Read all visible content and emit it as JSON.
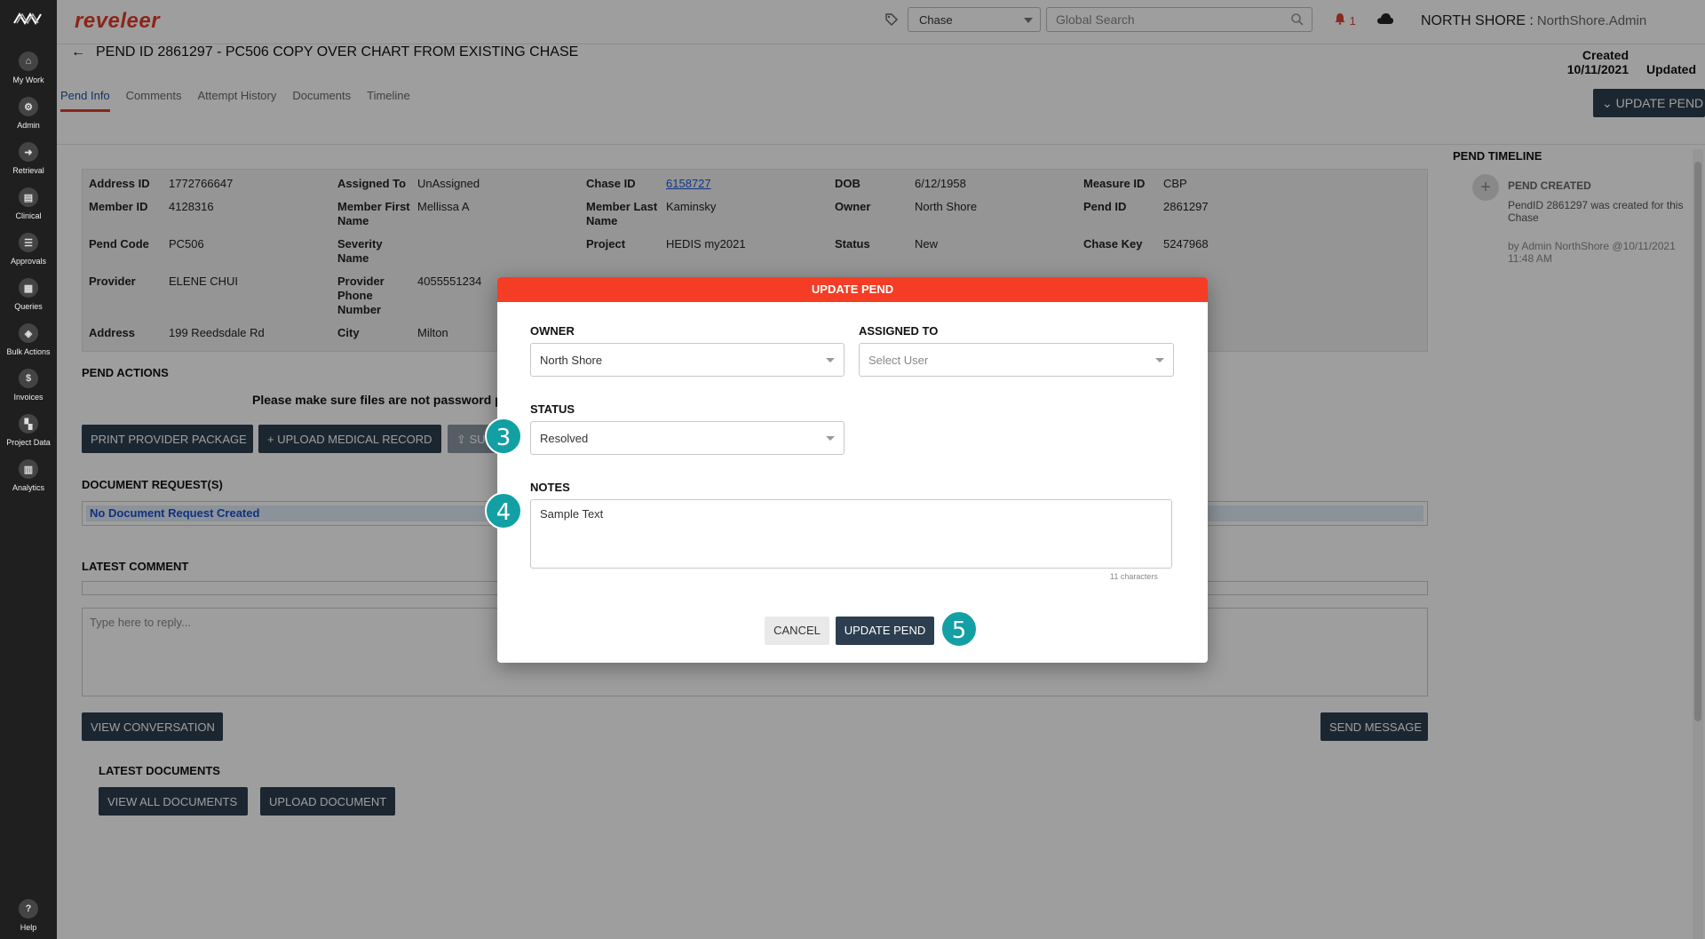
{
  "app": {
    "brand": "reveleer"
  },
  "sidebar": {
    "items": [
      {
        "label": "My Work",
        "icon": "home-icon",
        "glyph": "⌂"
      },
      {
        "label": "Admin",
        "icon": "admin-icon",
        "glyph": "⚙"
      },
      {
        "label": "Retrieval",
        "icon": "retrieval-icon",
        "glyph": "➜"
      },
      {
        "label": "Clinical",
        "icon": "clinical-icon",
        "glyph": "▤"
      },
      {
        "label": "Approvals",
        "icon": "approvals-icon",
        "glyph": "☰"
      },
      {
        "label": "Queries",
        "icon": "queries-icon",
        "glyph": "▦"
      },
      {
        "label": "Bulk Actions",
        "icon": "bulk-actions-icon",
        "glyph": "◈"
      },
      {
        "label": "Invoices",
        "icon": "invoices-icon",
        "glyph": "$"
      },
      {
        "label": "Project Data",
        "icon": "project-data-icon",
        "glyph": "▚"
      },
      {
        "label": "Analytics",
        "icon": "analytics-icon",
        "glyph": "▥"
      }
    ],
    "help": {
      "label": "Help",
      "glyph": "?"
    }
  },
  "header": {
    "search_type": "Chase",
    "search_placeholder": "Global Search",
    "notifications": "1",
    "org": "NORTH SHORE :",
    "user": "NorthShore.Admin"
  },
  "page": {
    "title": "PEND ID 2861297 - PC506 COPY OVER CHART FROM EXISTING CHASE",
    "created_label": "Created",
    "created_date": "10/11/2021",
    "updated_label": "Updated",
    "update_button": "UPDATE PEND",
    "tabs": [
      "Pend Info",
      "Comments",
      "Attempt History",
      "Documents",
      "Timeline"
    ]
  },
  "info": {
    "address_id": {
      "label": "Address ID",
      "value": "1772766647"
    },
    "member_id": {
      "label": "Member ID",
      "value": "4128316"
    },
    "pend_code": {
      "label": "Pend Code",
      "value": "PC506"
    },
    "provider": {
      "label": "Provider",
      "value": "ELENE CHUI"
    },
    "address": {
      "label": "Address",
      "value": "199 Reedsdale Rd"
    },
    "assigned_to": {
      "label": "Assigned To",
      "value": "UnAssigned"
    },
    "member_first": {
      "label1": "Member First",
      "label2": "Name",
      "value": "Mellissa A"
    },
    "severity": {
      "label1": "Severity",
      "label2": "Name",
      "value": ""
    },
    "provider_phone": {
      "label1": "Provider",
      "label2": "Phone",
      "label3": "Number",
      "value": "4055551234"
    },
    "city": {
      "label": "City",
      "value": "Milton"
    },
    "chase_id": {
      "label": "Chase ID",
      "value": "6158727"
    },
    "member_last": {
      "label1": "Member Last",
      "label2": "Name",
      "value": "Kaminsky"
    },
    "project": {
      "label": "Project",
      "value": "HEDIS my2021"
    },
    "dob": {
      "label": "DOB",
      "value": "6/12/1958"
    },
    "owner": {
      "label": "Owner",
      "value": "North Shore"
    },
    "status": {
      "label": "Status",
      "value": "New"
    },
    "measure_id": {
      "label": "Measure ID",
      "value": "CBP"
    },
    "pend_id": {
      "label": "Pend ID",
      "value": "2861297"
    },
    "chase_key": {
      "label": "Chase Key",
      "value": "5247968"
    }
  },
  "actions": {
    "title": "PEND ACTIONS",
    "warning": "Please make sure files are not password pro",
    "print_btn": "PRINT PROVIDER PACKAGE",
    "upload_btn": "+ UPLOAD MEDICAL RECORD",
    "submit_btn": "⇪ SU"
  },
  "documents": {
    "title": "DOCUMENT REQUEST(S)",
    "empty": "No Document Request Created"
  },
  "comments": {
    "title": "LATEST COMMENT",
    "reply_placeholder": "Type here to reply...",
    "view_btn": "VIEW CONVERSATION",
    "send_btn": "SEND MESSAGE"
  },
  "latest_docs": {
    "title": "LATEST DOCUMENTS",
    "view_all": "VIEW ALL DOCUMENTS",
    "upload": "UPLOAD DOCUMENT"
  },
  "timeline": {
    "title": "PEND TIMELINE",
    "event_title": "PEND CREATED",
    "event_text": "PendID 2861297 was created for this Chase",
    "event_by": "by Admin NorthShore @10/11/2021 11:48 AM"
  },
  "modal": {
    "title": "UPDATE PEND",
    "owner_label": "OWNER",
    "owner_value": "North Shore",
    "assigned_label": "ASSIGNED TO",
    "assigned_placeholder": "Select User",
    "status_label": "STATUS",
    "status_value": "Resolved",
    "notes_label": "NOTES",
    "notes_value": "Sample Text",
    "char_count": "11 characters",
    "cancel": "CANCEL",
    "submit": "UPDATE PEND"
  },
  "steps": [
    "3",
    "4",
    "5"
  ],
  "colors": {
    "accent": "#f53d25",
    "brand": "#e13c2a",
    "button": "#2c3e50",
    "step": "#12a0a4"
  }
}
